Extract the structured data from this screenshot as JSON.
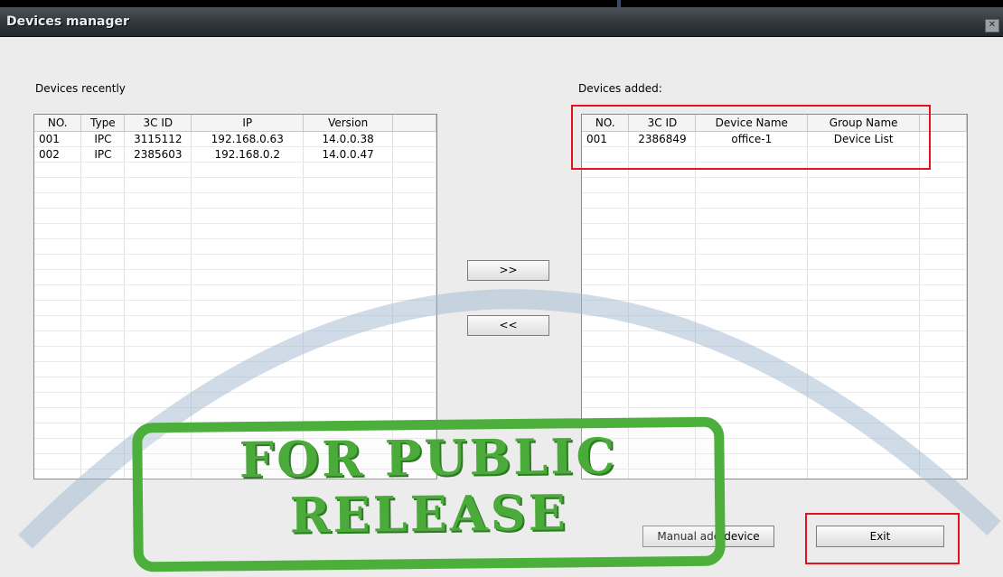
{
  "window": {
    "title": "Devices manager",
    "close_glyph": "✕"
  },
  "recent": {
    "label": "Devices recently",
    "columns": [
      "NO.",
      "Type",
      "3C ID",
      "IP",
      "Version"
    ],
    "rows": [
      [
        "001",
        "IPC",
        "3115112",
        "192.168.0.63",
        "14.0.0.38"
      ],
      [
        "002",
        "IPC",
        "2385603",
        "192.168.0.2",
        "14.0.0.47"
      ]
    ]
  },
  "added": {
    "label": "Devices added:",
    "columns": [
      "NO.",
      "3C ID",
      "Device Name",
      "Group Name"
    ],
    "rows": [
      [
        "001",
        "2386849",
        "office-1",
        "Device List"
      ]
    ]
  },
  "buttons": {
    "add": ">>",
    "remove": "<<",
    "manual_add": "Manual add device",
    "exit": "Exit"
  },
  "stamp": {
    "line1": "FOR PUBLIC",
    "line2": "RELEASE"
  },
  "colors": {
    "highlight": "#e0141e",
    "stamp": "#4caf3c",
    "arc": "#9fbad0"
  }
}
